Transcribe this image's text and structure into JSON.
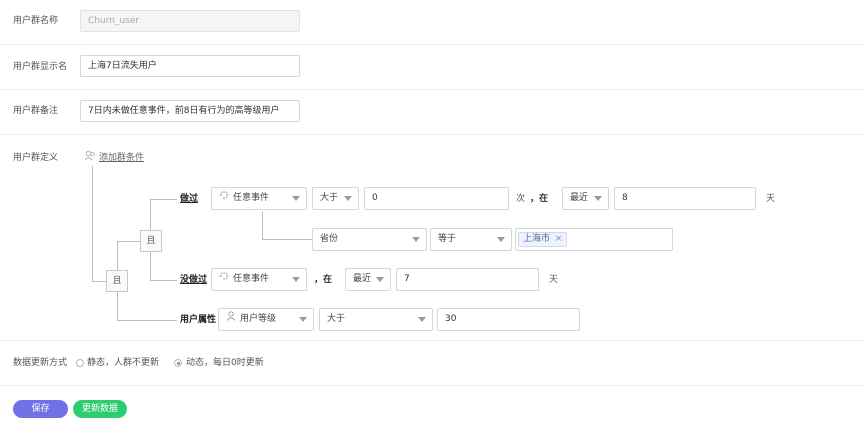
{
  "form": {
    "name_label": "用户群名称",
    "name_value": "Churn_user",
    "display_label": "用户群显示名",
    "display_value": "上海7日流失用户",
    "note_label": "用户群备注",
    "note_value": "7日内未做任意事件，前8日有行为的高等级用户",
    "definition_label": "用户群定义",
    "add_condition": "添加群条件"
  },
  "conditions": {
    "and_outer": "且",
    "and_inner": "且",
    "did": {
      "label": "做过",
      "event": "任意事件",
      "operator": "大于",
      "count": "0",
      "count_unit": "次",
      "in_label": "，在",
      "time_mode": "最近",
      "time_value": "8",
      "time_unit": "天",
      "filter": {
        "property": "省份",
        "operator": "等于",
        "tag": "上海市",
        "tag_close": "×"
      }
    },
    "not_did": {
      "label": "没做过",
      "event": "任意事件",
      "in_label": "，在",
      "time_mode": "最近",
      "time_value": "7",
      "time_unit": "天"
    },
    "user_attr": {
      "label": "用户属性",
      "property": "用户等级",
      "operator": "大于",
      "value": "30"
    }
  },
  "update": {
    "label": "数据更新方式",
    "static_option": "静态，人群不更新",
    "dynamic_option": "动态，每日0时更新",
    "selected": "dynamic"
  },
  "buttons": {
    "save": "保存",
    "update_data": "更新数据"
  },
  "colors": {
    "save_button": "#7071e8",
    "update_button": "#2ecc71"
  }
}
